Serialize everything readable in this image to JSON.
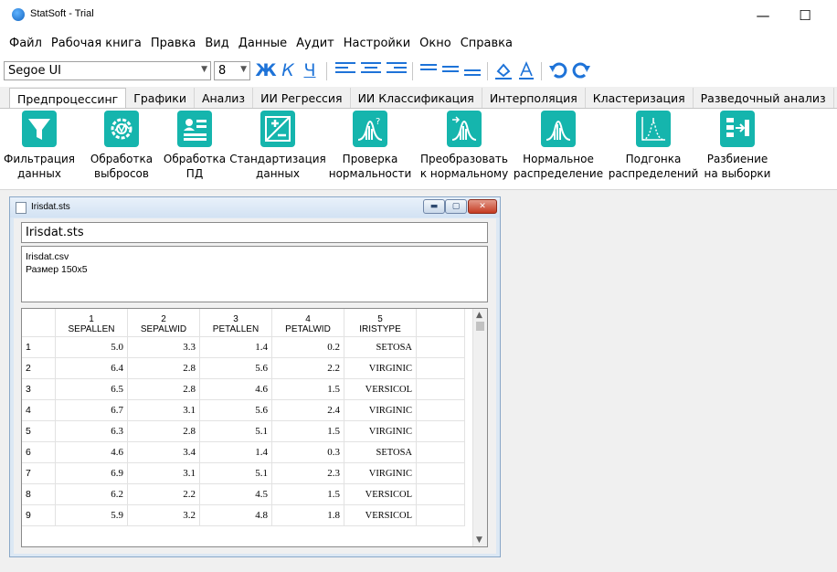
{
  "window": {
    "title": "StatSoft - Trial",
    "min_glyph": "—",
    "max_glyph": "☐",
    "close_glyph": "✕"
  },
  "menu": [
    "Файл",
    "Рабочая книга",
    "Правка",
    "Вид",
    "Данные",
    "Аудит",
    "Настройки",
    "Окно",
    "Справка"
  ],
  "toolbar": {
    "font": "Segoe UI",
    "size": "8",
    "bold": "Ж",
    "italic": "К",
    "underline": "Ч"
  },
  "ribbon_tabs": [
    "Предпроцессинг",
    "Графики",
    "Анализ",
    "ИИ Регрессия",
    "ИИ Классификация",
    "Интерполяция",
    "Кластеризация",
    "Разведочный анализ"
  ],
  "active_tab": 0,
  "ribbon_buttons": [
    {
      "line1": "Фильтрация",
      "line2": "данных",
      "icon": "funnel-icon"
    },
    {
      "line1": "Обработка",
      "line2": "выбросов",
      "icon": "outlier-gear-icon"
    },
    {
      "line1": "Обработка",
      "line2": "ПД",
      "icon": "id-card-icon"
    },
    {
      "line1": "Стандартизация",
      "line2": "данных",
      "icon": "plus-minus-icon"
    },
    {
      "line1": "Проверка",
      "line2": "нормальности",
      "icon": "normality-check-icon"
    },
    {
      "line1": "Преобразовать",
      "line2": "к нормальному",
      "icon": "transform-normal-icon"
    },
    {
      "line1": "Нормальное",
      "line2": "распределение",
      "icon": "normal-distribution-icon"
    },
    {
      "line1": "Подгонка",
      "line2": "распределений",
      "icon": "distribution-fit-icon"
    },
    {
      "line1": "Разбиение",
      "line2": "на выборки",
      "icon": "split-samples-icon"
    }
  ],
  "child_window": {
    "title": "Irisdat.sts",
    "file_label": "Irisdat.sts",
    "info_line1": "Irisdat.csv",
    "info_line2": "Размер 150x5"
  },
  "table": {
    "columns": [
      {
        "num": "1",
        "name": "SEPALLEN"
      },
      {
        "num": "2",
        "name": "SEPALWID"
      },
      {
        "num": "3",
        "name": "PETALLEN"
      },
      {
        "num": "4",
        "name": "PETALWID"
      },
      {
        "num": "5",
        "name": "IRISTYPE"
      }
    ],
    "rows": [
      [
        "1",
        "5.0",
        "3.3",
        "1.4",
        "0.2",
        "SETOSA"
      ],
      [
        "2",
        "6.4",
        "2.8",
        "5.6",
        "2.2",
        "VIRGINIC"
      ],
      [
        "3",
        "6.5",
        "2.8",
        "4.6",
        "1.5",
        "VERSICOL"
      ],
      [
        "4",
        "6.7",
        "3.1",
        "5.6",
        "2.4",
        "VIRGINIC"
      ],
      [
        "5",
        "6.3",
        "2.8",
        "5.1",
        "1.5",
        "VIRGINIC"
      ],
      [
        "6",
        "4.6",
        "3.4",
        "1.4",
        "0.3",
        "SETOSA"
      ],
      [
        "7",
        "6.9",
        "3.1",
        "5.1",
        "2.3",
        "VIRGINIC"
      ],
      [
        "8",
        "6.2",
        "2.2",
        "4.5",
        "1.5",
        "VERSICOL"
      ],
      [
        "9",
        "5.9",
        "3.2",
        "4.8",
        "1.8",
        "VERSICOL"
      ]
    ]
  },
  "colors": {
    "accent": "#1e73d8",
    "ribbon_icon": "#15b5ad"
  }
}
